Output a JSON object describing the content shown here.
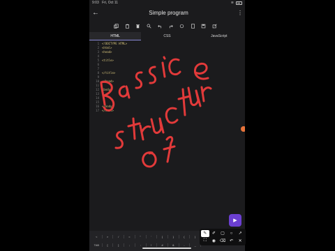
{
  "status_bar": {
    "time": "9:03",
    "date": "Fri, Oct 11"
  },
  "app_bar": {
    "title": "Simple program"
  },
  "tabs": [
    {
      "label": "HTML",
      "active": true
    },
    {
      "label": "CSS",
      "active": false
    },
    {
      "label": "JavaScript",
      "active": false
    }
  ],
  "editor_lines": [
    {
      "n": "1",
      "text": "<!DOCTYPE HTML>"
    },
    {
      "n": "2",
      "text": "<html>"
    },
    {
      "n": "3",
      "text": "<head>"
    },
    {
      "n": "4",
      "text": ""
    },
    {
      "n": "5",
      "text": "<title>"
    },
    {
      "n": "6",
      "text": ""
    },
    {
      "n": "7",
      "text": ""
    },
    {
      "n": "8",
      "text": "</title>"
    },
    {
      "n": "9",
      "text": ""
    },
    {
      "n": "10",
      "text": "</head>"
    },
    {
      "n": "11",
      "text": ""
    },
    {
      "n": "12",
      "text": "<body>"
    },
    {
      "n": "13",
      "text": ""
    },
    {
      "n": "14",
      "text": ""
    },
    {
      "n": "15",
      "text": ""
    },
    {
      "n": "16",
      "text": "</body>"
    },
    {
      "n": "17",
      "text": "</html>"
    }
  ],
  "keyboard_row_1": [
    "<",
    ">",
    "/",
    "=",
    "\"",
    "'",
    "{",
    "}",
    "(",
    ")"
  ],
  "keyboard_row_2": [
    "TAB",
    "[",
    "]",
    ";",
    ":",
    "!",
    "#",
    "&",
    "-",
    "_"
  ],
  "fab_icon": "play-icon",
  "handwritten_text": "Basic structure of",
  "colors": {
    "ink": "#e23a3a",
    "tag": "#d7c47b",
    "accent": "#6b3fd1",
    "background": "#1b1b1d"
  }
}
